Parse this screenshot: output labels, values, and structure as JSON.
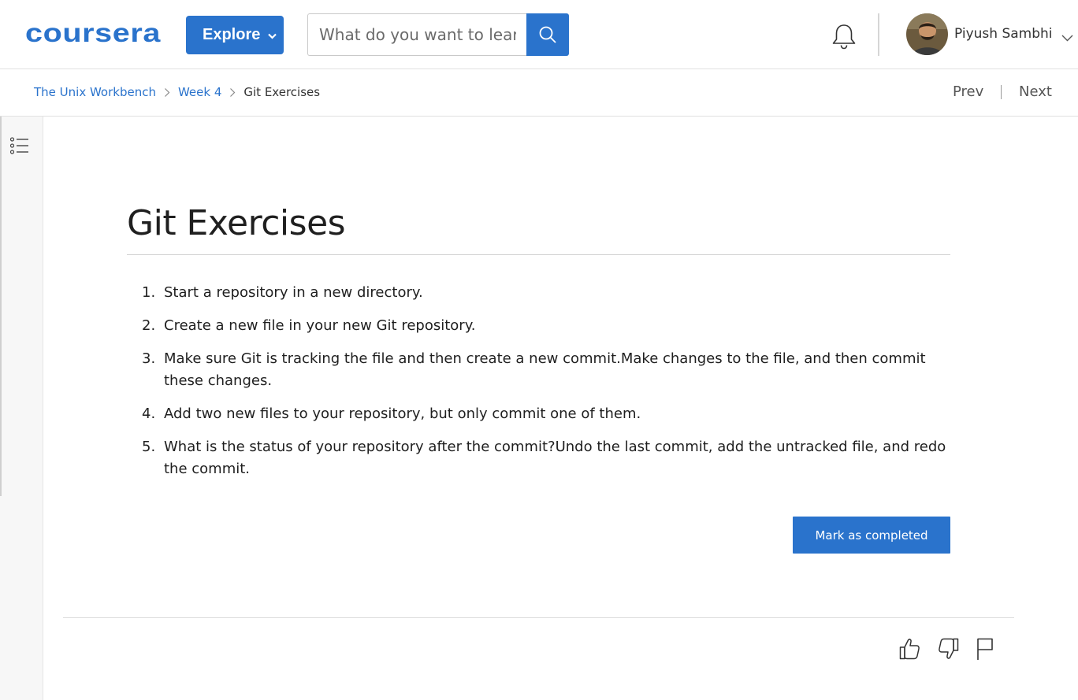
{
  "header": {
    "logo_text": "coursera",
    "explore_label": "Explore",
    "search_placeholder": "What do you want to learn?",
    "user_name": "Piyush Sambhi"
  },
  "breadcrumb": {
    "items": [
      "The Unix Workbench",
      "Week 4",
      "Git Exercises"
    ],
    "prev_label": "Prev",
    "next_label": "Next"
  },
  "main": {
    "title": "Git Exercises",
    "exercises": [
      {
        "num": "1.",
        "text": "Start a repository in a new directory."
      },
      {
        "num": "2.",
        "text": "Create a new file in your new Git repository."
      },
      {
        "num": "3.",
        "text": "Make sure Git is tracking the file and then create a new commit.Make changes to the file, and then commit these changes."
      },
      {
        "num": "4.",
        "text": "Add two new files to your repository, but only commit one of them."
      },
      {
        "num": "5.",
        "text": "What is the status of your repository after the commit?Undo the last commit, add the untracked file, and redo the commit."
      }
    ],
    "mark_completed_label": "Mark as completed"
  },
  "icons": {
    "search": "search-icon",
    "notifications": "bell-icon",
    "menu": "list-icon",
    "like": "thumbs-up-icon",
    "dislike": "thumbs-down-icon",
    "report": "flag-icon"
  },
  "colors": {
    "brand_blue": "#2a73cc",
    "text_dark": "#1f1f1f"
  }
}
